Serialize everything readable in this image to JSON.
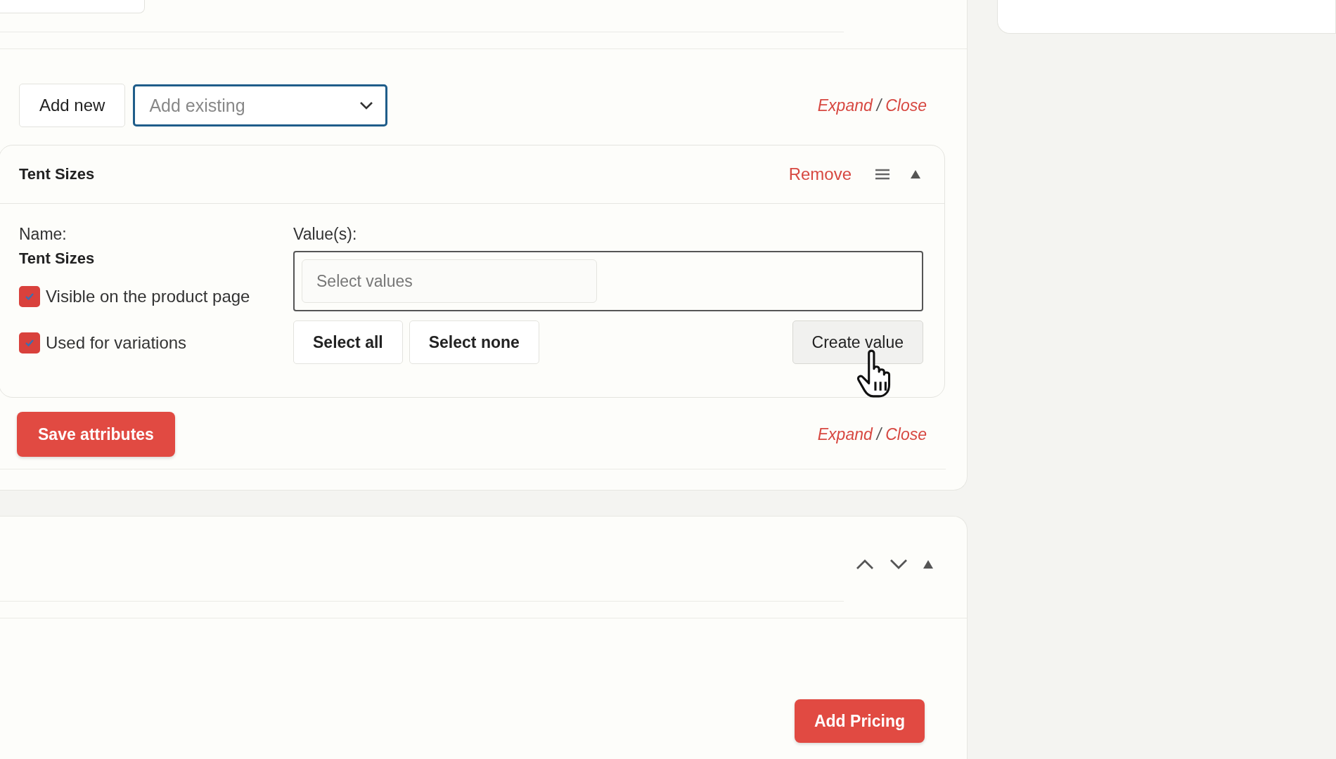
{
  "toolbar": {
    "add_new": "Add new",
    "add_existing": {
      "placeholder": "Add existing"
    },
    "expand": "Expand",
    "separator": "/",
    "close": "Close"
  },
  "attribute": {
    "title": "Tent Sizes",
    "remove": "Remove",
    "expanded": true,
    "name_label": "Name:",
    "name": "Tent Sizes",
    "options": [
      {
        "label": "Visible on the product page",
        "checked": true
      },
      {
        "label": "Used for variations",
        "checked": true
      }
    ],
    "values_label": "Value(s):",
    "values_field": {
      "placeholder": "Select values"
    },
    "buttons": [
      "Select all",
      "Select none"
    ],
    "create_button": "Create value"
  },
  "footer": {
    "save": "Save attributes",
    "expand": "Expand",
    "separator": "/",
    "close": "Close"
  },
  "pricing": {
    "expanded": true,
    "add_pricing": "Add Pricing"
  }
}
